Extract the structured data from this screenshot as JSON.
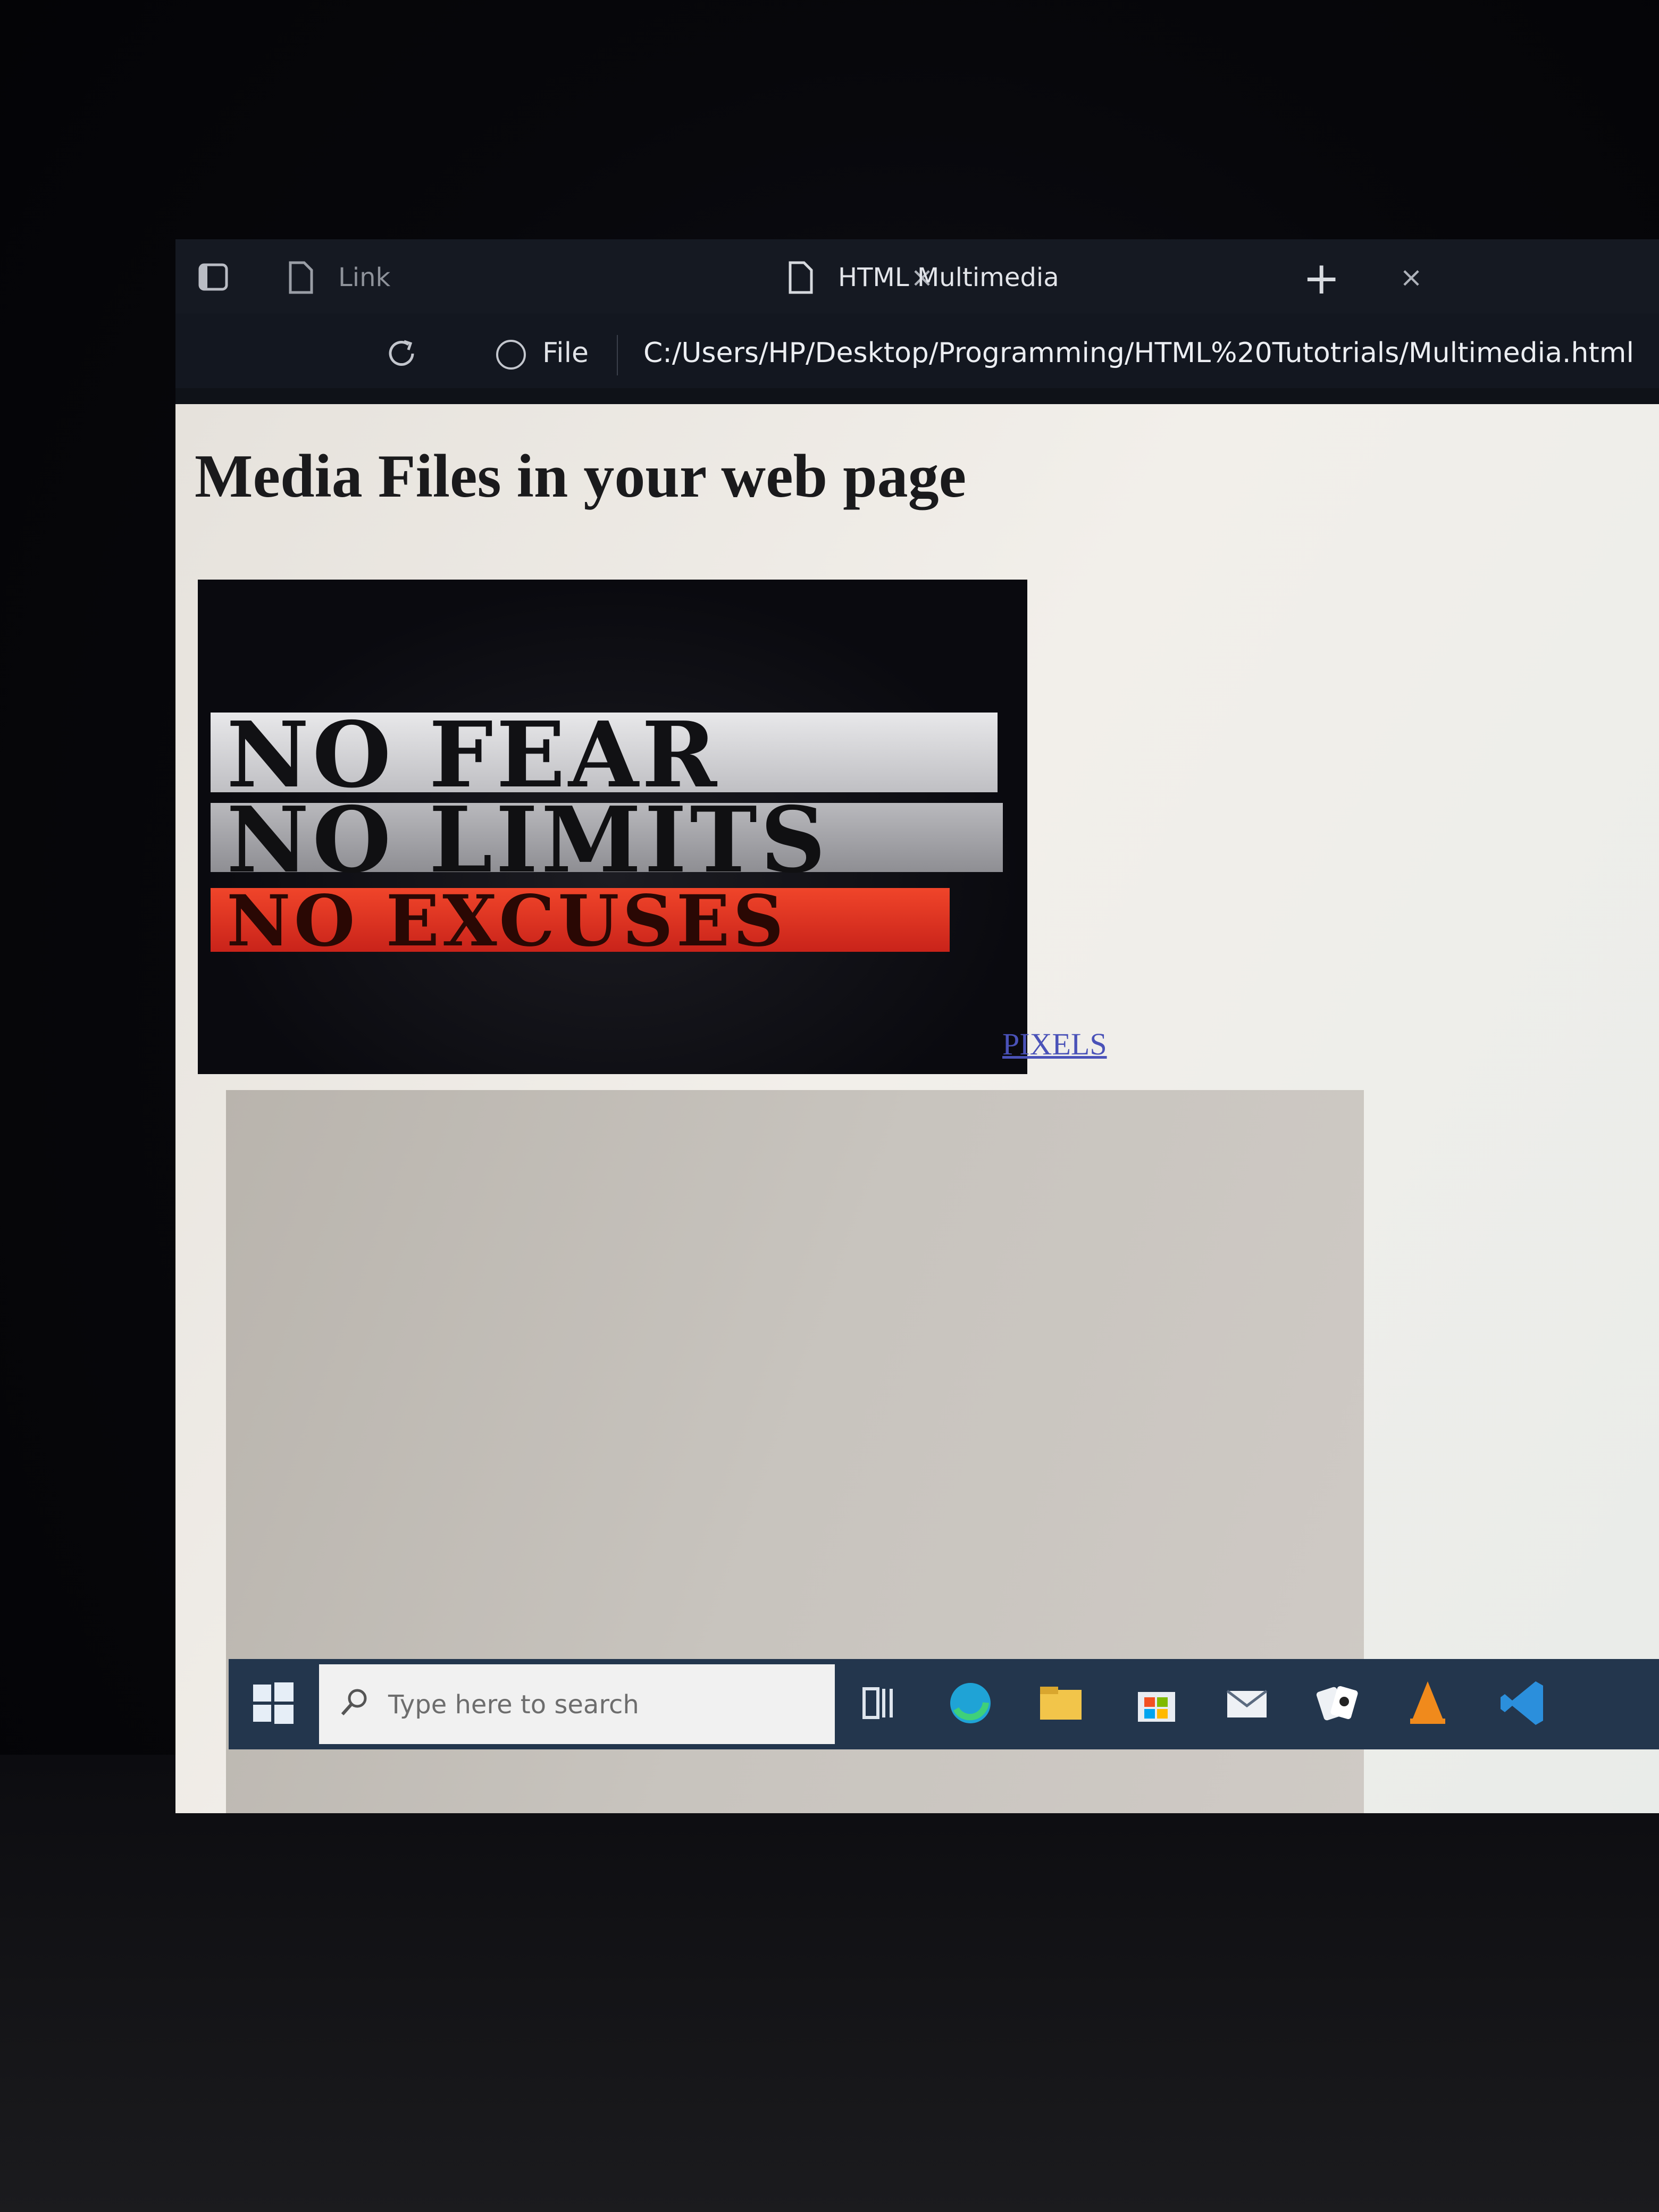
{
  "tabs": [
    {
      "label": "Link",
      "close": "×"
    },
    {
      "label": "HTML Multimedia",
      "close": "×"
    }
  ],
  "new_tab_label": "+",
  "addressbar": {
    "scheme_label": "File",
    "url": "C:/Users/HP/Desktop/Programming/HTML%20Tutotrials/Multimedia.html"
  },
  "page": {
    "heading": "Media Files in your web page",
    "image_text": [
      "NO FEAR",
      "NO LIMITS",
      "NO EXCUSES"
    ],
    "link_text": "PIXELS"
  },
  "taskbar": {
    "search_placeholder": "Type here to search",
    "icons": [
      "start-icon",
      "task-view-icon",
      "edge-icon",
      "file-explorer-icon",
      "store-icon",
      "mail-icon",
      "solitaire-icon",
      "vlc-icon",
      "vscode-icon"
    ]
  },
  "colors": {
    "link": "#4a52b8",
    "taskbar": "#23364d",
    "poster_red": "#e0321f"
  }
}
